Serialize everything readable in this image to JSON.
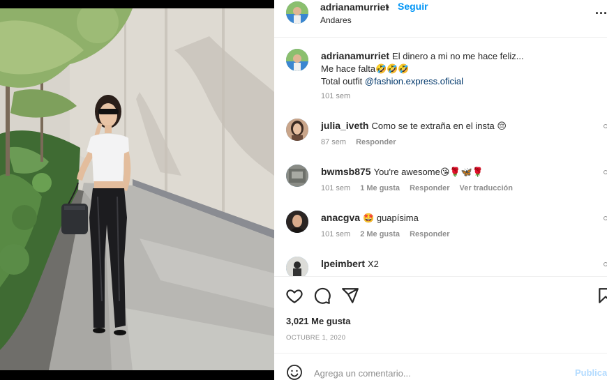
{
  "post": {
    "username": "adrianamurriet",
    "dot": "•",
    "follow_label": "Seguir",
    "location": "Andares",
    "more_label": "..."
  },
  "caption": {
    "username": "adrianamurriet",
    "line1": "El dinero a mi no me hace feliz...",
    "line2": "Me hace falta🤣🤣🤣",
    "line3_prefix": "Total outfit ",
    "mention": "@fashion.express.oficial",
    "time": "101 sem"
  },
  "comments": [
    {
      "username": "julia_iveth",
      "text": "Como se te extraña en el insta 😔",
      "time": "87 sem",
      "likes": "",
      "reply": "Responder",
      "translate": ""
    },
    {
      "username": "bwmsb875",
      "text": "You're awesome😘🌹🦋🌹",
      "time": "101 sem",
      "likes": "1 Me gusta",
      "reply": "Responder",
      "translate": "Ver traducción"
    },
    {
      "username": "anacgva",
      "text": "🤩 guapísima",
      "time": "101 sem",
      "likes": "2 Me gusta",
      "reply": "Responder",
      "translate": ""
    },
    {
      "username": "lpeimbert",
      "text": "X2",
      "time": "",
      "likes": "",
      "reply": "",
      "translate": ""
    }
  ],
  "actions": {
    "icons": [
      "heart-icon",
      "comment-icon",
      "share-icon",
      "bookmark-icon"
    ],
    "likes_count": "3,021 Me gusta",
    "date": "OCTUBRE 1, 2020"
  },
  "add_comment": {
    "placeholder": "Agrega un comentario...",
    "publish_label": "Publicar"
  },
  "colors": {
    "accent": "#0095f6",
    "text": "#262626",
    "secondary": "#8e8e8e",
    "mention": "#00376b",
    "publish_disabled": "#b3dbff"
  }
}
